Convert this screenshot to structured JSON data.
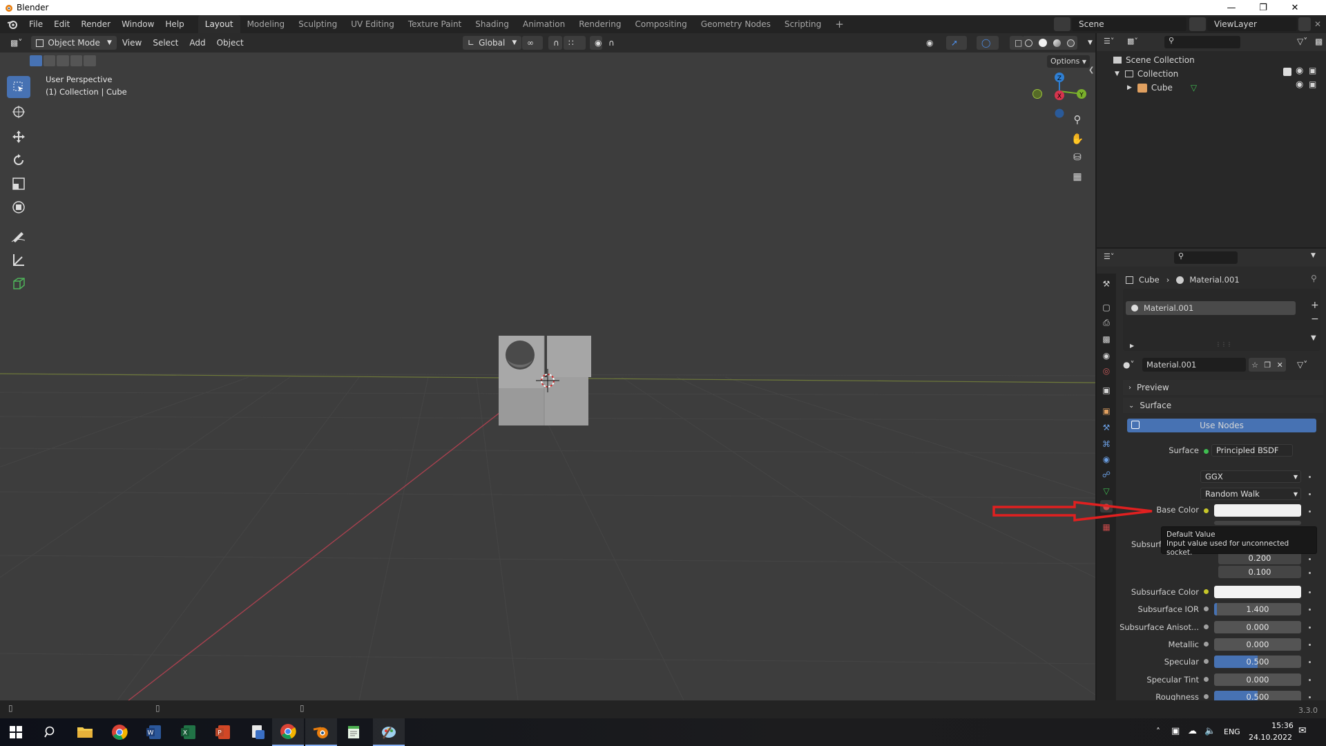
{
  "window": {
    "title": "Blender"
  },
  "menu": [
    "File",
    "Edit",
    "Render",
    "Window",
    "Help"
  ],
  "workspaces": [
    "Layout",
    "Modeling",
    "Sculpting",
    "UV Editing",
    "Texture Paint",
    "Shading",
    "Animation",
    "Rendering",
    "Compositing",
    "Geometry Nodes",
    "Scripting"
  ],
  "active_workspace": "Layout",
  "scene": "Scene",
  "view_layer": "ViewLayer",
  "viewport_header": {
    "mode": "Object Mode",
    "menus": [
      "View",
      "Select",
      "Add",
      "Object"
    ],
    "orientation": "Global",
    "options": "Options"
  },
  "viewport": {
    "perspective": "User Perspective",
    "collection_info": "(1) Collection | Cube",
    "gizmo": {
      "z": "Z",
      "y": "Y",
      "x": "X"
    }
  },
  "outliner": {
    "items": [
      "Scene Collection",
      "Collection",
      "Cube"
    ]
  },
  "properties": {
    "breadcrumb": {
      "object": "Cube",
      "material": "Material.001"
    },
    "slot": "Material.001",
    "material_name": "Material.001",
    "panels": {
      "preview": "Preview",
      "surface": "Surface"
    },
    "use_nodes": "Use Nodes",
    "surface_label": "Surface",
    "surface_value": "Principled BSDF",
    "distribution": "GGX",
    "subsurface_method": "Random Walk",
    "base_color_label": "Base Color",
    "subsurface_partial": "Subsurf",
    "radius_values": [
      "0.200",
      "0.100"
    ],
    "fields": [
      {
        "label": "Subsurface Color",
        "value": "",
        "kind": "color",
        "fill": 0
      },
      {
        "label": "Subsurface IOR",
        "value": "1.400",
        "kind": "num",
        "fill": 0.03
      },
      {
        "label": "Subsurface Anisot...",
        "value": "0.000",
        "kind": "num",
        "fill": 0
      },
      {
        "label": "Metallic",
        "value": "0.000",
        "kind": "num",
        "fill": 0
      },
      {
        "label": "Specular",
        "value": "0.500",
        "kind": "num",
        "fill": 0.5
      },
      {
        "label": "Specular Tint",
        "value": "0.000",
        "kind": "num",
        "fill": 0
      },
      {
        "label": "Roughness",
        "value": "0.500",
        "kind": "num",
        "fill": 0.5
      }
    ]
  },
  "tooltip": {
    "title": "Default Value",
    "body": "Input value used for unconnected socket."
  },
  "version": "3.3.0",
  "taskbar": {
    "lang": "ENG",
    "time": "15:36",
    "date": "24.10.2022"
  },
  "colors": {
    "accent": "#4772b3",
    "arrow": "#e02020",
    "socket_yellow": "#c7c729",
    "socket_green": "#3fbd51",
    "socket_gray": "#a1a1a1"
  }
}
